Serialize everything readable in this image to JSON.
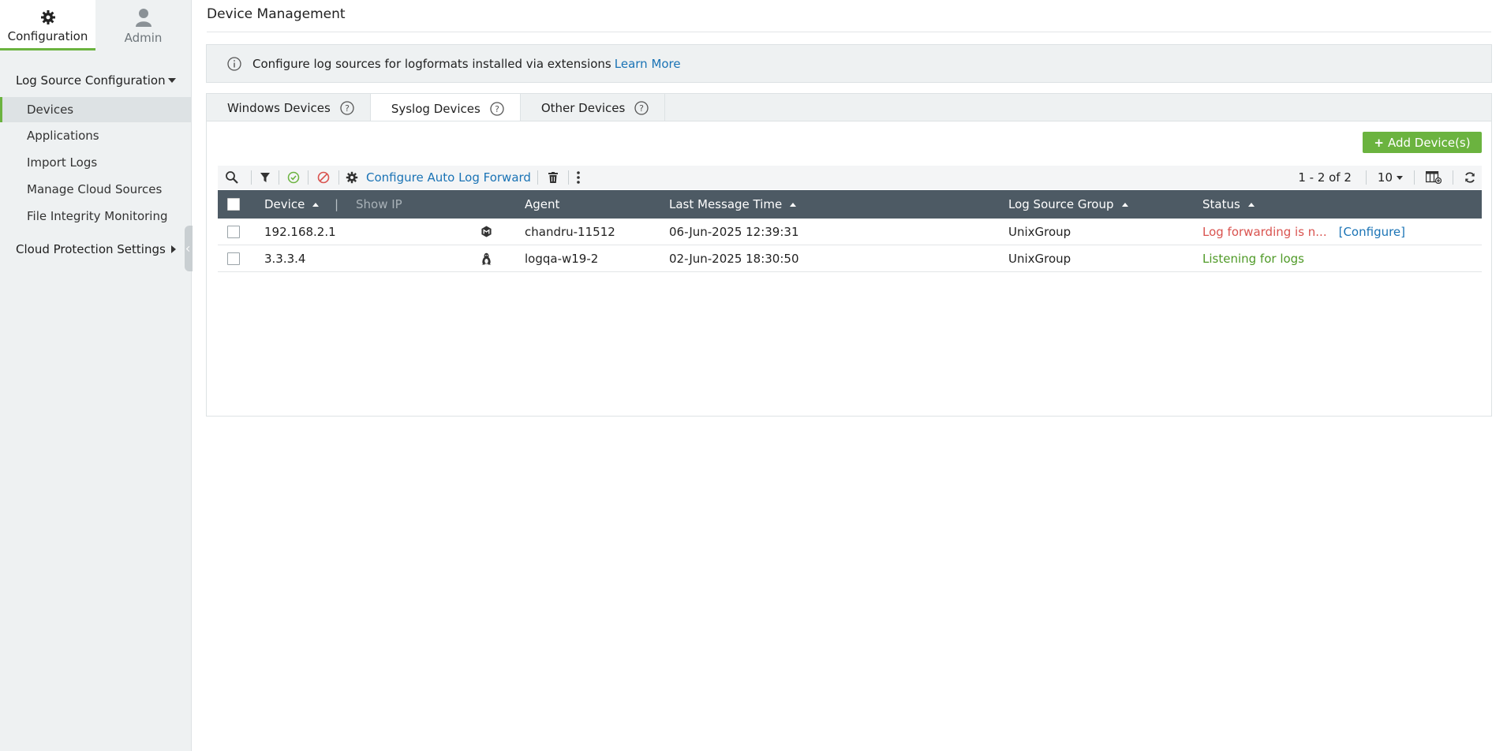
{
  "sidebar": {
    "top_tabs": [
      {
        "label": "Configuration",
        "icon": "gear-icon"
      },
      {
        "label": "Admin",
        "icon": "user-icon"
      }
    ],
    "section_log_source": "Log Source Configuration",
    "items": [
      {
        "label": "Devices"
      },
      {
        "label": "Applications"
      },
      {
        "label": "Import Logs"
      },
      {
        "label": "Manage Cloud Sources"
      },
      {
        "label": "File Integrity Monitoring"
      }
    ],
    "section_cloud": "Cloud Protection Settings"
  },
  "page": {
    "title": "Device Management"
  },
  "banner": {
    "text": "Configure log sources for logformats installed via extensions",
    "link": "Learn More"
  },
  "tabs": [
    {
      "label": "Windows Devices"
    },
    {
      "label": "Syslog Devices"
    },
    {
      "label": "Other Devices"
    }
  ],
  "actions": {
    "add_device": "Add Device(s)",
    "configure_auto_forward": "Configure Auto Log Forward"
  },
  "pager": {
    "range": "1 - 2 of 2",
    "page_size": "10"
  },
  "table": {
    "headers": {
      "device": "Device",
      "show_ip": "Show IP",
      "agent": "Agent",
      "last_message_time": "Last Message Time",
      "log_source_group": "Log Source Group",
      "status": "Status"
    },
    "rows": [
      {
        "device": "192.168.2.1",
        "os_icon": "unix-icon",
        "agent": "chandru-11512",
        "last_message_time": "06-Jun-2025 12:39:31",
        "group": "UnixGroup",
        "status": "Log forwarding is n...",
        "status_link": "[Configure]"
      },
      {
        "device": "3.3.3.4",
        "os_icon": "linux-icon",
        "agent": "logqa-w19-2",
        "last_message_time": "02-Jun-2025 18:30:50",
        "group": "UnixGroup",
        "status": "Listening for logs",
        "status_link": ""
      }
    ]
  },
  "colors": {
    "accent_green": "#6bb33f",
    "link_blue": "#1a73b5",
    "header_dark": "#4d5a64",
    "error_red": "#d9534f"
  }
}
